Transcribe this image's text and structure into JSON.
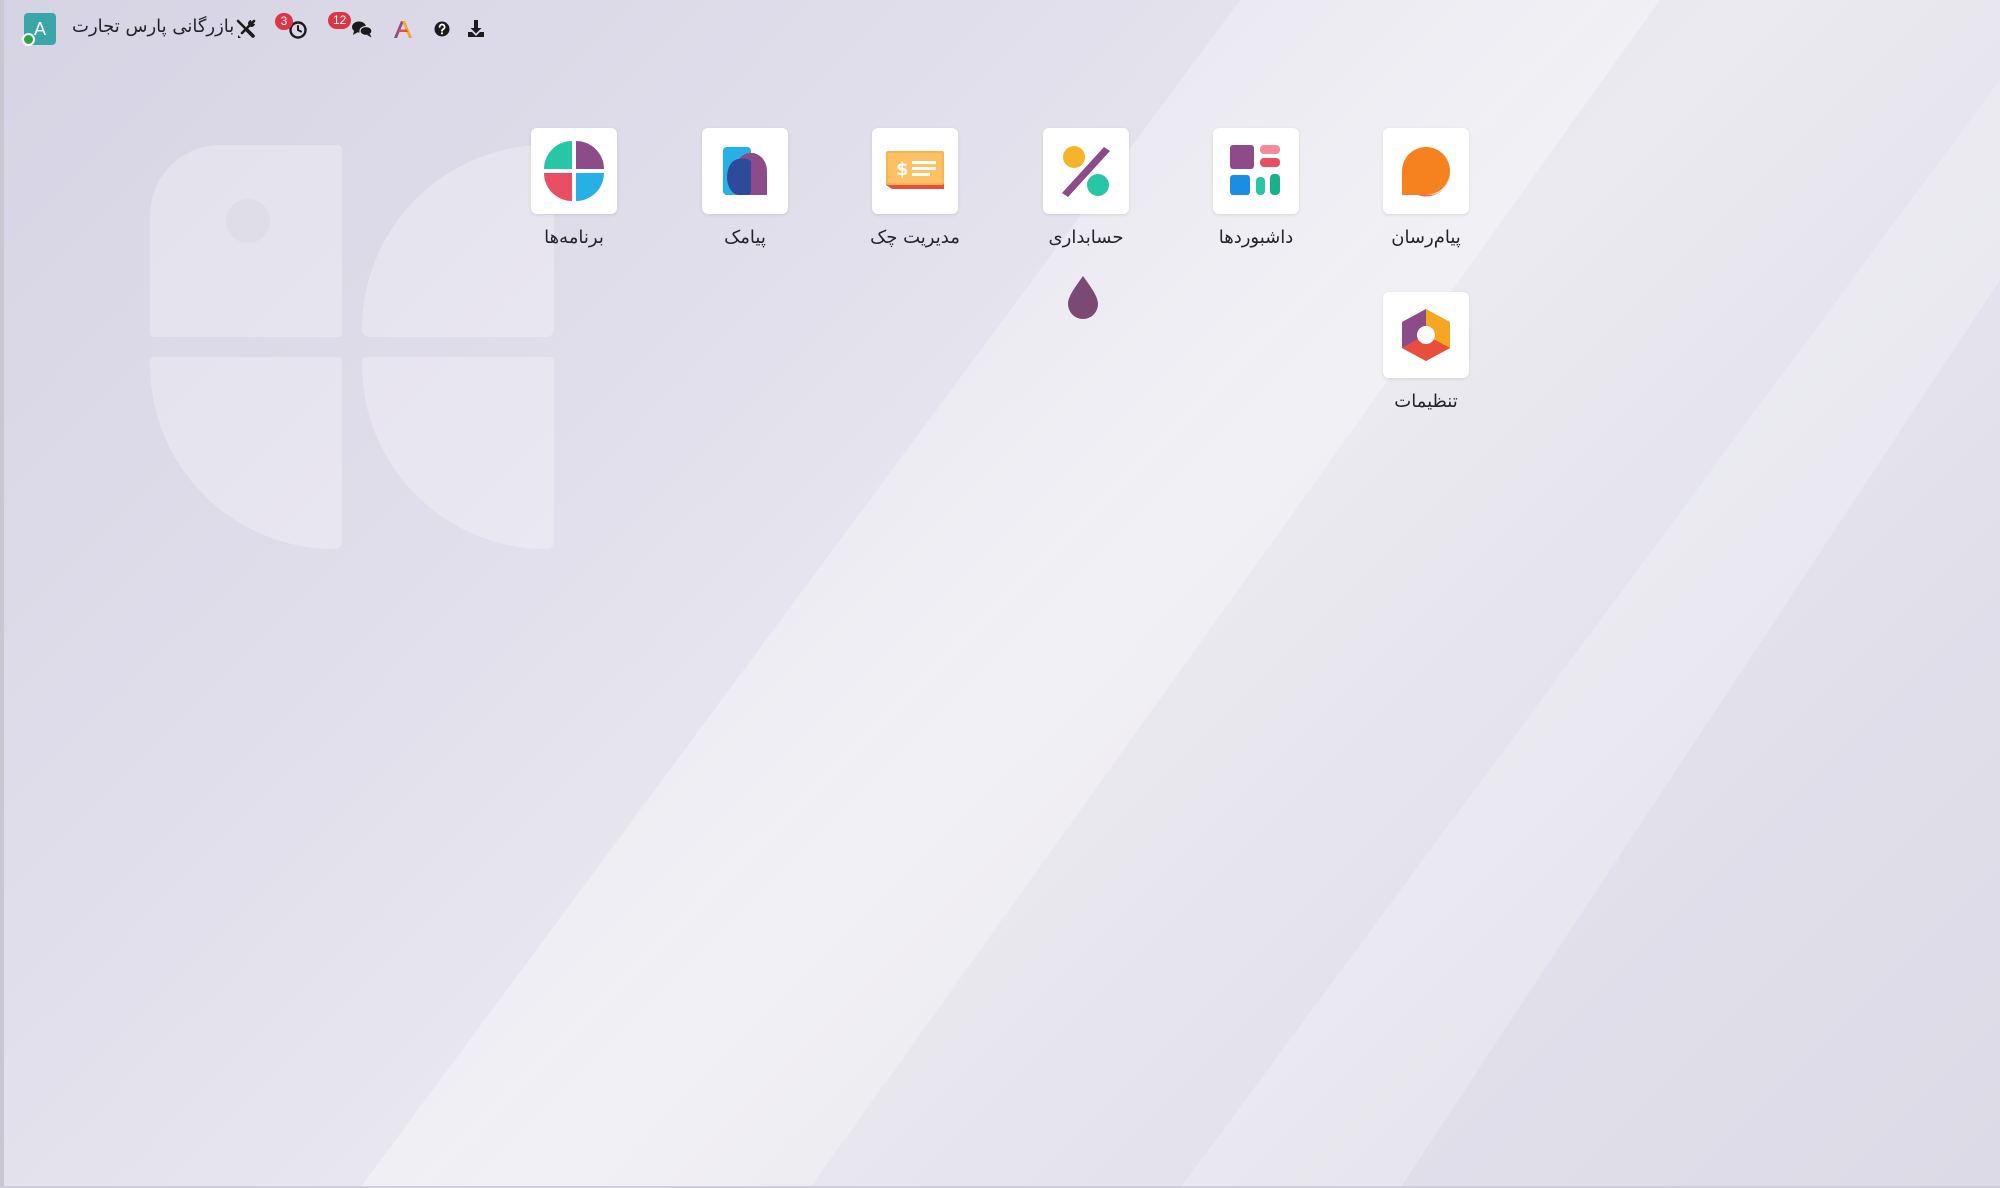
{
  "topbar": {
    "avatar_letter": "A",
    "company_name": "بازرگانی پارس تجارت",
    "activity_badge": "3",
    "messages_badge": "12",
    "icons": [
      "debug-tools-icon",
      "activity-clock-icon",
      "chat-icon",
      "brand-logo-icon",
      "help-icon",
      "download-icon"
    ]
  },
  "apps": [
    {
      "label": "پیام‌رسان",
      "icon": "discuss-icon"
    },
    {
      "label": "داشبوردها",
      "icon": "dashboards-icon"
    },
    {
      "label": "حسابداری",
      "icon": "accounting-icon"
    },
    {
      "label": "مدیریت چک",
      "icon": "check-management-icon"
    },
    {
      "label": "پیامک",
      "icon": "sms-icon"
    },
    {
      "label": "برنامه‌ها",
      "icon": "apps-icon"
    },
    {
      "label": "تنظیمات",
      "icon": "settings-icon"
    }
  ],
  "colors": {
    "avatar": "#3aa6a8",
    "badge": "#dc3545",
    "status_online": "#28a745",
    "accent_purple": "#8e4b8a",
    "accent_teal": "#26c6a6",
    "accent_orange": "#f5821f"
  }
}
